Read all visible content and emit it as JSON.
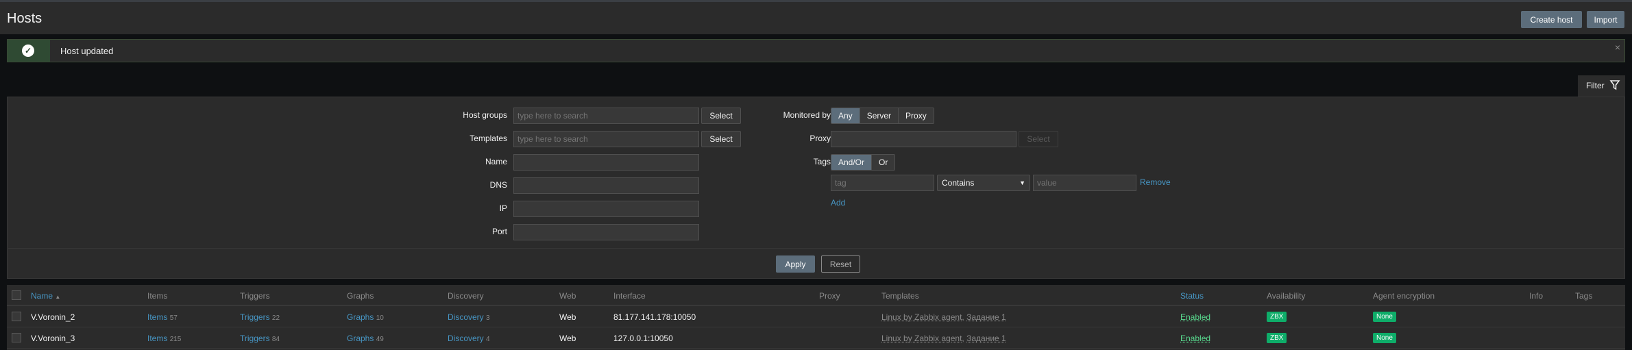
{
  "header": {
    "title": "Hosts",
    "create_label": "Create host",
    "import_label": "Import"
  },
  "message": {
    "text": "Host updated",
    "close": "×"
  },
  "filter": {
    "tab_label": "Filter",
    "host_groups": {
      "label": "Host groups",
      "placeholder": "type here to search",
      "button": "Select"
    },
    "templates": {
      "label": "Templates",
      "placeholder": "type here to search",
      "button": "Select"
    },
    "name": {
      "label": "Name",
      "value": ""
    },
    "dns": {
      "label": "DNS",
      "value": ""
    },
    "ip": {
      "label": "IP",
      "value": ""
    },
    "port": {
      "label": "Port",
      "value": ""
    },
    "monitored_by": {
      "label": "Monitored by",
      "options": [
        "Any",
        "Server",
        "Proxy"
      ],
      "selected": "Any"
    },
    "proxy": {
      "label": "Proxy",
      "button": "Select"
    },
    "tags": {
      "label": "Tags",
      "options": [
        "And/Or",
        "Or"
      ],
      "selected": "And/Or",
      "tag_placeholder": "tag",
      "operator": "Contains",
      "value_placeholder": "value",
      "remove": "Remove",
      "add": "Add"
    },
    "apply": "Apply",
    "reset": "Reset"
  },
  "table": {
    "columns": {
      "name": "Name",
      "items": "Items",
      "triggers": "Triggers",
      "graphs": "Graphs",
      "discovery": "Discovery",
      "web": "Web",
      "interface": "Interface",
      "proxy": "Proxy",
      "templates": "Templates",
      "status": "Status",
      "availability": "Availability",
      "encryption": "Agent encryption",
      "info": "Info",
      "tags": "Tags"
    },
    "sort_arrow": "▲",
    "rows": [
      {
        "name": "V.Voronin_2",
        "items": "Items",
        "items_count": "57",
        "triggers": "Triggers",
        "triggers_count": "22",
        "graphs": "Graphs",
        "graphs_count": "10",
        "discovery": "Discovery",
        "discovery_count": "3",
        "web": "Web",
        "interface": "81.177.141.178:10050",
        "template1": "Linux by Zabbix agent",
        "sep": ", ",
        "template2": "Задание 1",
        "status": "Enabled",
        "availability": "ZBX",
        "encryption": "None"
      },
      {
        "name": "V.Voronin_3",
        "items": "Items",
        "items_count": "215",
        "triggers": "Triggers",
        "triggers_count": "84",
        "graphs": "Graphs",
        "graphs_count": "49",
        "discovery": "Discovery",
        "discovery_count": "4",
        "web": "Web",
        "interface": "127.0.0.1:10050",
        "template1": "Linux by Zabbix agent",
        "sep": ", ",
        "template2": "Задание 1",
        "status": "Enabled",
        "availability": "ZBX",
        "encryption": "None"
      }
    ]
  }
}
